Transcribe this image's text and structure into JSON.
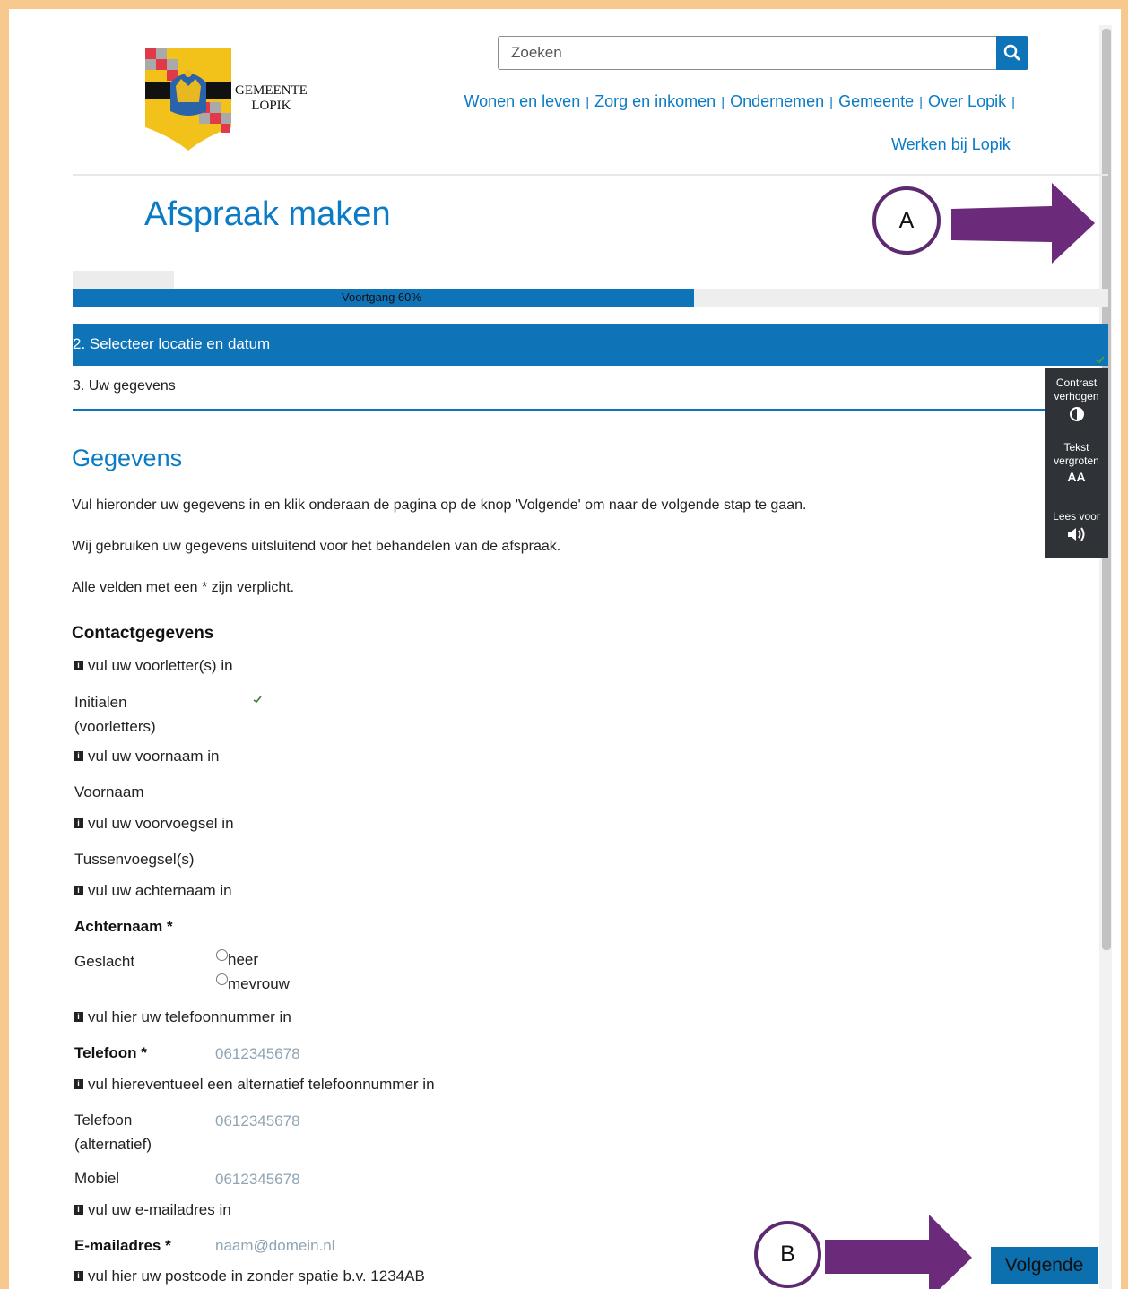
{
  "search": {
    "placeholder": "Zoeken"
  },
  "logo": {
    "line1": "GEMEENTE",
    "line2": "LOPIK"
  },
  "nav": {
    "items": [
      "Wonen en leven",
      "Zorg en inkomen",
      "Ondernemen",
      "Gemeente",
      "Over Lopik"
    ],
    "separator": "|",
    "second_row": "Werken bij Lopik"
  },
  "page_title": "Afspraak maken",
  "annotations": {
    "a": "A",
    "b": "B",
    "arrow_color": "#5b2a70"
  },
  "progress": {
    "label": "Voortgang 60%",
    "value": 0.6
  },
  "steps": {
    "active": "2. Selecteer locatie en datum",
    "next": "3. Uw gegevens"
  },
  "accessibility": {
    "contrast": "Contrast verhogen",
    "text": "Tekst vergroten",
    "text_glyph": "AA",
    "read": "Lees voor"
  },
  "content": {
    "heading": "Gegevens",
    "p1": "Vul hieronder uw gegevens in en klik onderaan de pagina op de knop 'Volgende' om naar de volgende stap te gaan.",
    "p2": "Wij gebruiken uw gegevens uitsluitend voor het behandelen van de afspraak.",
    "p3": "Alle velden met een * zijn verplicht.",
    "section": "Contactgegevens"
  },
  "form": {
    "hint_initials": "vul uw voorletter(s) in",
    "label_initials_1": "Initialen",
    "label_initials_2": "(voorletters)",
    "hint_firstname": "vul uw voornaam in",
    "label_firstname": "Voornaam",
    "hint_prefix": "vul uw voorvoegsel in",
    "label_prefix": "Tussenvoegsel(s)",
    "hint_lastname": "vul uw achternaam in",
    "label_lastname": "Achternaam *",
    "label_gender": "Geslacht",
    "gender_options": [
      "heer",
      "mevrouw"
    ],
    "hint_phone": "vul hier uw telefoonnummer in",
    "label_phone": "Telefoon *",
    "phone_placeholder": "0612345678",
    "hint_alt_phone": "vul hiereventueel een alternatief telefoonnummer in",
    "label_alt_phone_1": "Telefoon",
    "label_alt_phone_2": "(alternatief)",
    "alt_phone_placeholder": "0612345678",
    "label_mobile": "Mobiel",
    "mobile_placeholder": "0612345678",
    "hint_email": "vul uw e-mailadres in",
    "label_email": "E-mailadres *",
    "email_placeholder": "naam@domein.nl",
    "hint_postcode": "vul hier uw postcode in zonder spatie b.v. 1234AB"
  },
  "button_next": "Volgende",
  "colors": {
    "primary": "#0f73b8",
    "link": "#0a7bc4",
    "frame": "#f7c98f",
    "toolbar": "#2f3338"
  }
}
